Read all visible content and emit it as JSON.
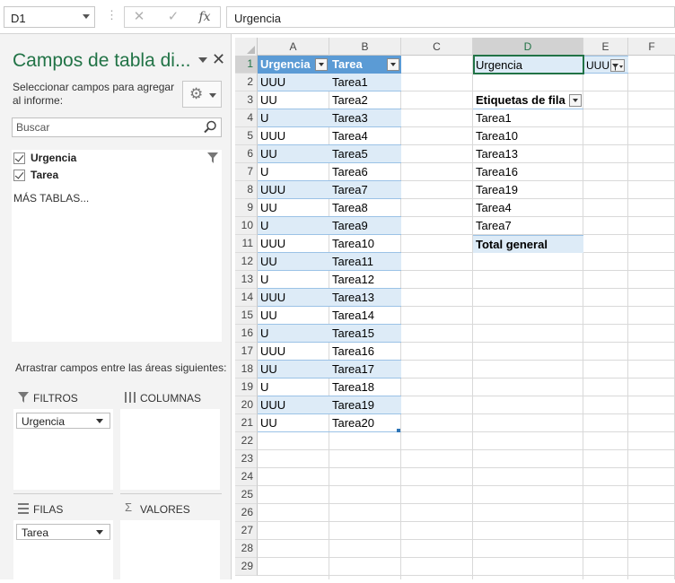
{
  "formula_bar": {
    "name_box": "D1",
    "formula": "Urgencia"
  },
  "field_pane": {
    "title": "Campos de tabla di...",
    "instructions": "Seleccionar campos para agregar al informe:",
    "search_placeholder": "Buscar",
    "fields": [
      {
        "label": "Urgencia",
        "checked": true
      },
      {
        "label": "Tarea",
        "checked": true
      }
    ],
    "more_tables": "MÁS TABLAS...",
    "drag_instructions": "Arrastrar campos entre las áreas siguientes:",
    "areas": {
      "filters": {
        "label": "FILTROS",
        "items": [
          "Urgencia"
        ]
      },
      "columns": {
        "label": "COLUMNAS",
        "items": []
      },
      "rows": {
        "label": "FILAS",
        "items": [
          "Tarea"
        ]
      },
      "values": {
        "label": "VALORES",
        "items": []
      }
    }
  },
  "sheet": {
    "selected_cell": "D1",
    "columns": [
      "A",
      "B",
      "C",
      "D",
      "E",
      "F"
    ],
    "rows": [
      "1",
      "2",
      "3",
      "4",
      "5",
      "6",
      "7",
      "8",
      "9",
      "10",
      "11",
      "12",
      "13",
      "14",
      "15",
      "16",
      "17",
      "18",
      "19",
      "20",
      "21",
      "22",
      "23",
      "24",
      "25",
      "26",
      "27",
      "28",
      "29"
    ],
    "table": {
      "headers": [
        "Urgencia",
        "Tarea"
      ],
      "data": [
        [
          "UUU",
          "Tarea1"
        ],
        [
          "UU",
          "Tarea2"
        ],
        [
          "U",
          "Tarea3"
        ],
        [
          "UUU",
          "Tarea4"
        ],
        [
          "UU",
          "Tarea5"
        ],
        [
          "U",
          "Tarea6"
        ],
        [
          "UUU",
          "Tarea7"
        ],
        [
          "UU",
          "Tarea8"
        ],
        [
          "U",
          "Tarea9"
        ],
        [
          "UUU",
          "Tarea10"
        ],
        [
          "UU",
          "Tarea11"
        ],
        [
          "U",
          "Tarea12"
        ],
        [
          "UUU",
          "Tarea13"
        ],
        [
          "UU",
          "Tarea14"
        ],
        [
          "U",
          "Tarea15"
        ],
        [
          "UUU",
          "Tarea16"
        ],
        [
          "UU",
          "Tarea17"
        ],
        [
          "U",
          "Tarea18"
        ],
        [
          "UUU",
          "Tarea19"
        ],
        [
          "UU",
          "Tarea20"
        ]
      ]
    },
    "pivot": {
      "filter_label": "Urgencia",
      "filter_value": "UUU",
      "row_header": "Etiquetas de fila",
      "items": [
        "Tarea1",
        "Tarea10",
        "Tarea13",
        "Tarea16",
        "Tarea19",
        "Tarea4",
        "Tarea7"
      ],
      "total": "Total general"
    }
  },
  "colors": {
    "accent_green": "#217346",
    "table_header": "#5b9bd5",
    "table_band": "#ddebf7"
  }
}
